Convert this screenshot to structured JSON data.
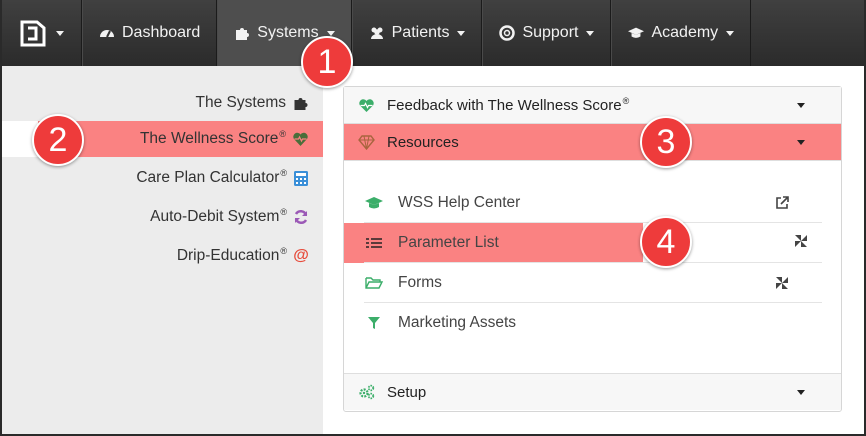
{
  "navbar": {
    "items": [
      {
        "label": "Dashboard",
        "icon": "dashboard-icon"
      },
      {
        "label": "Systems",
        "icon": "puzzle-icon"
      },
      {
        "label": "Patients",
        "icon": "users-icon"
      },
      {
        "label": "Support",
        "icon": "lifebuoy-icon"
      },
      {
        "label": "Academy",
        "icon": "graduation-cap-icon"
      }
    ]
  },
  "sidebar": {
    "items": [
      {
        "label": "The Systems",
        "reg": "",
        "icon": "puzzle-icon",
        "icon_color": "#333333"
      },
      {
        "label": "The Wellness Score",
        "reg": "®",
        "icon": "heart-pulse-icon",
        "icon_color": "#3b6b3b"
      },
      {
        "label": "Care Plan Calculator",
        "reg": "®",
        "icon": "calculator-icon",
        "icon_color": "#3a8fd8"
      },
      {
        "label": "Auto-Debit System",
        "reg": "®",
        "icon": "refresh-icon",
        "icon_color": "#9b59b6"
      },
      {
        "label": "Drip-Education",
        "reg": "®",
        "icon": "at-icon",
        "icon_color": "#e74c3c"
      }
    ]
  },
  "panel": {
    "feedback": {
      "label": "Feedback with The Wellness Score",
      "reg": "®"
    },
    "resources": {
      "label": "Resources"
    },
    "setup": {
      "label": "Setup"
    },
    "resource_items": [
      {
        "label": "WSS Help Center",
        "icon": "graduation-cap-icon",
        "action": "external-link-icon"
      },
      {
        "label": "Parameter List",
        "icon": "list-icon",
        "action": "pinwheel-icon"
      },
      {
        "label": "Forms",
        "icon": "folder-open-icon",
        "action": "pinwheel-icon"
      },
      {
        "label": "Marketing Assets",
        "icon": "filter-icon",
        "action": ""
      }
    ]
  },
  "markers": [
    "1",
    "2",
    "3",
    "4"
  ],
  "colors": {
    "highlight": "#fa8282",
    "marker": "#ee3b3b",
    "green_icon": "#3cae6a",
    "navbar": "#333333"
  }
}
